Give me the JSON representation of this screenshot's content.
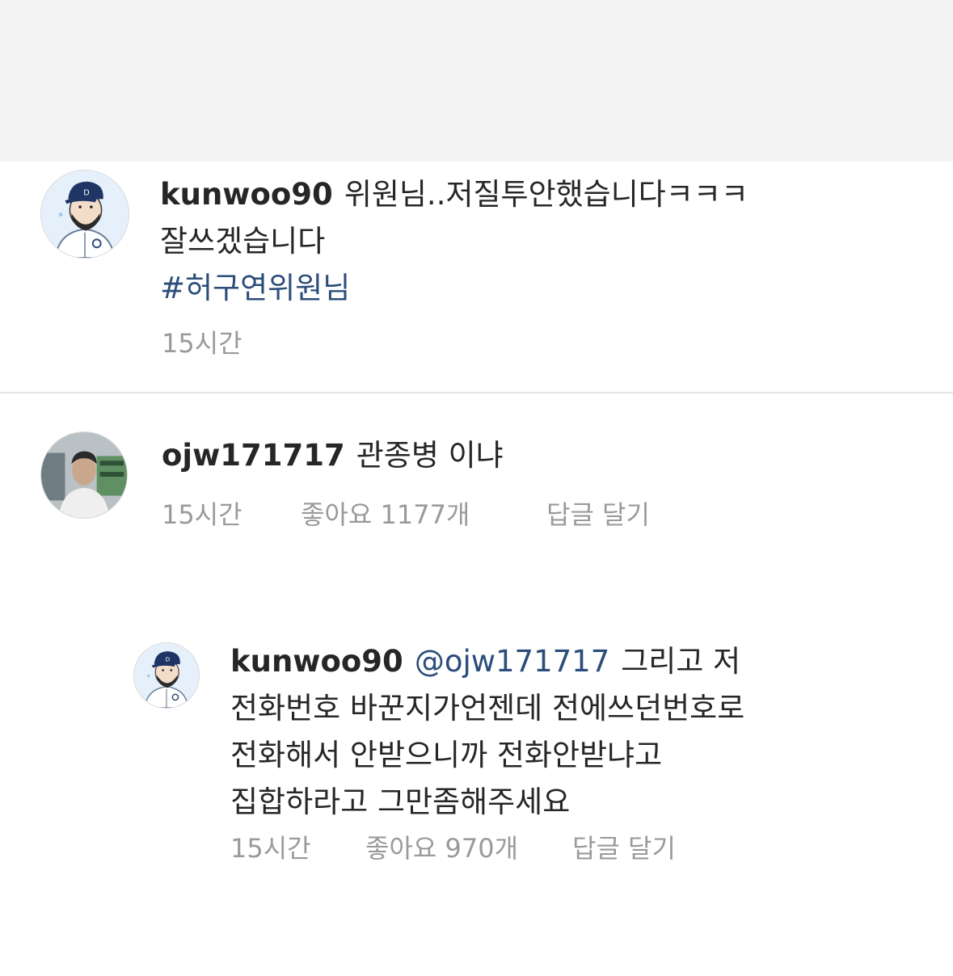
{
  "post": {
    "username": "kunwoo90",
    "line1": "위원님..저질투안했습니다ㅋㅋㅋ",
    "line2": "잘쓰겠습니다",
    "hashtag": "#허구연위원님",
    "time": "15시간"
  },
  "comment": {
    "username": "ojw171717",
    "text": "관종병 이냐",
    "time": "15시간",
    "likes": "좋아요 1177개",
    "reply_label": "답글 달기"
  },
  "reply": {
    "username": "kunwoo90",
    "mention": "@ojw171717",
    "line1": "그리고 저",
    "line2": "전화번호 바꾼지가언젠데 전에쓰던번호로",
    "line3": "전화해서 안받으니까 전화안받냐고",
    "line4": "집합하라고 그만좀해주세요",
    "time": "15시간",
    "likes": "좋아요 970개",
    "reply_label": "답글 달기"
  },
  "colors": {
    "text": "#262626",
    "meta": "#9a9a9a",
    "hashtag": "#2a4d7a",
    "background": "#ffffff"
  }
}
